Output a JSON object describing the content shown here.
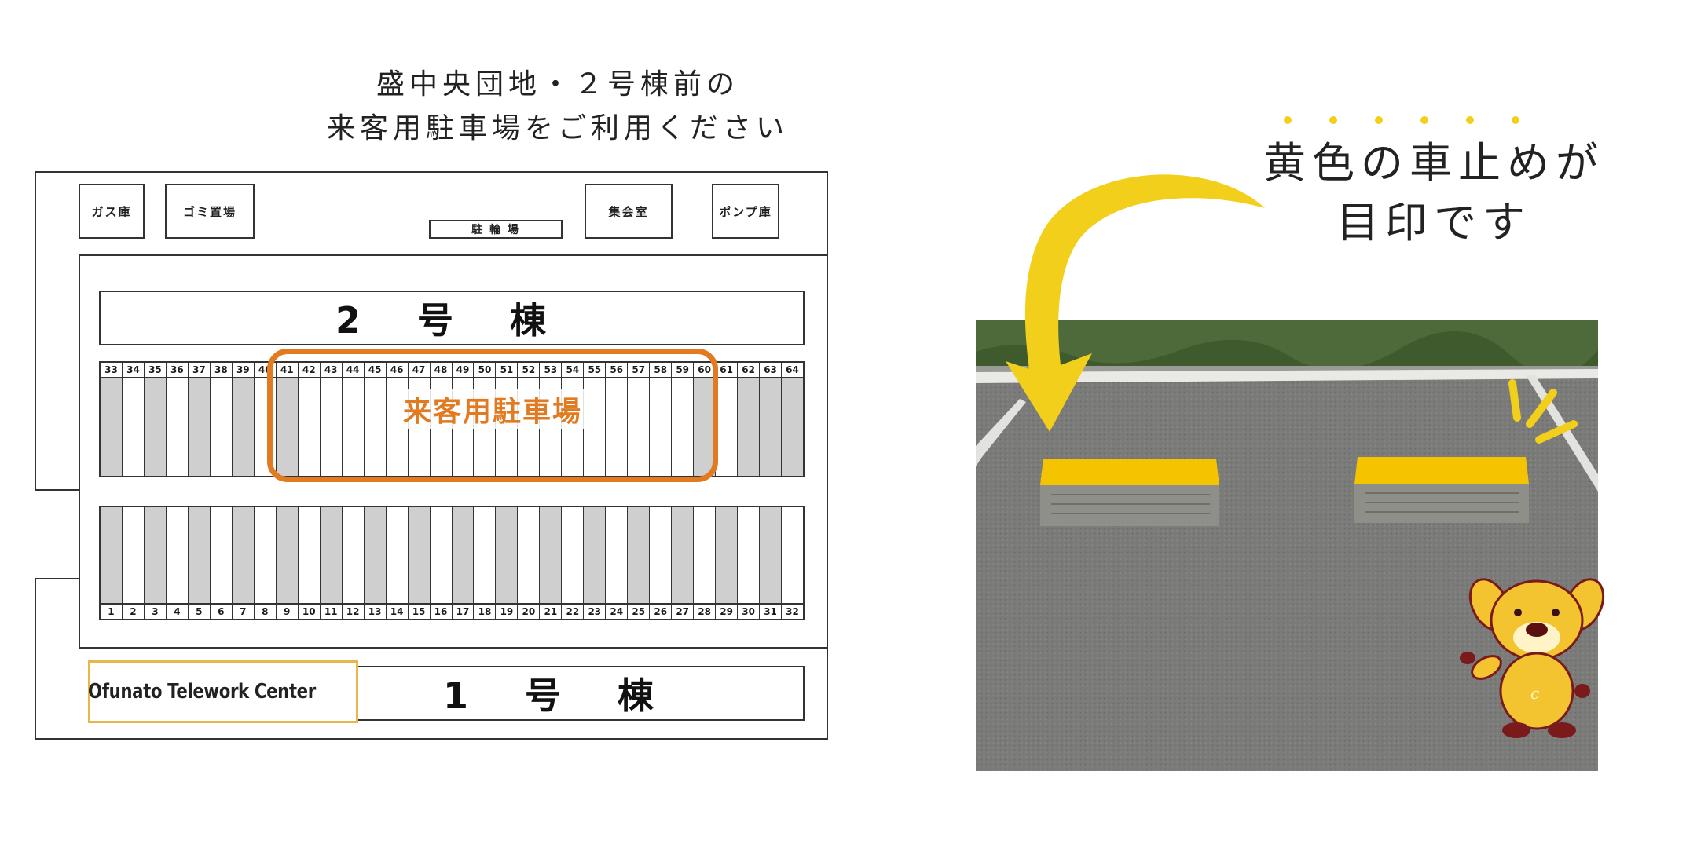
{
  "header": {
    "line1": "盛中央団地・２号棟前の",
    "line2": "来客用駐車場をご利用ください"
  },
  "map": {
    "facilities": {
      "gas": "ガス庫",
      "garbage": "ゴミ置場",
      "bicycle": "駐 輪 場",
      "meeting": "集会室",
      "pump": "ポンプ庫"
    },
    "building2": "2 号 棟",
    "building1": "1 号 棟",
    "top_row_numbers": [
      "33",
      "34",
      "35",
      "36",
      "37",
      "38",
      "39",
      "40",
      "41",
      "42",
      "43",
      "44",
      "45",
      "46",
      "47",
      "48",
      "49",
      "50",
      "51",
      "52",
      "53",
      "54",
      "55",
      "56",
      "57",
      "58",
      "59",
      "60",
      "61",
      "62",
      "63",
      "64"
    ],
    "bottom_row_numbers": [
      "1",
      "2",
      "3",
      "4",
      "5",
      "6",
      "7",
      "8",
      "9",
      "10",
      "11",
      "12",
      "13",
      "14",
      "15",
      "16",
      "17",
      "18",
      "19",
      "20",
      "21",
      "22",
      "23",
      "24",
      "25",
      "26",
      "27",
      "28",
      "29",
      "30",
      "31",
      "32"
    ],
    "visitor_label": "来客用駐車場",
    "logo_text": "Ofunato Telework Center"
  },
  "callout": {
    "line1": "黄色の車止めが",
    "line2": "目印です"
  },
  "colors": {
    "visitor_outline": "#e07b22",
    "marker_yellow": "#f2cf1a",
    "stopper_yellow": "#f5c400",
    "mascot_yellow": "#f4c430",
    "logo_border": "#e6b74a"
  },
  "icons": [
    "curved-arrow-icon",
    "sparkle-icon",
    "mascot-dog-icon",
    "logo-mark-icon"
  ]
}
